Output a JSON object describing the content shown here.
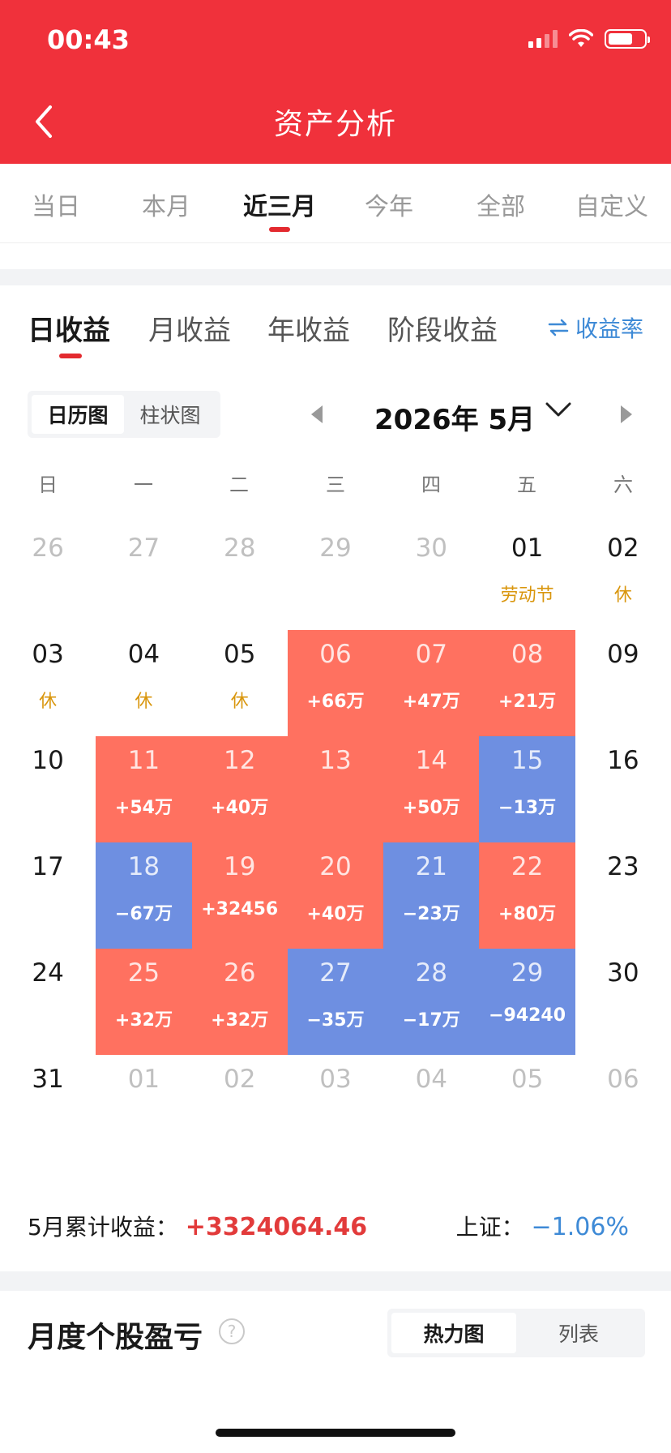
{
  "status": {
    "time": "00:43"
  },
  "header": {
    "title": "资产分析"
  },
  "period_tabs": [
    "当日",
    "本月",
    "近三月",
    "今年",
    "全部",
    "自定义"
  ],
  "period_active": 2,
  "profit_tabs": [
    "日收益",
    "月收益",
    "年收益",
    "阶段收益"
  ],
  "profit_active": 0,
  "rate_label": "收益率",
  "view_toggle": [
    "日历图",
    "柱状图"
  ],
  "month_label": "2026年 5月",
  "weekdays": [
    "日",
    "一",
    "二",
    "三",
    "四",
    "五",
    "六"
  ],
  "calendar": [
    [
      {
        "d": "26",
        "t": "faded"
      },
      {
        "d": "27",
        "t": "faded"
      },
      {
        "d": "28",
        "t": "faded"
      },
      {
        "d": "29",
        "t": "faded"
      },
      {
        "d": "30",
        "t": "faded"
      },
      {
        "d": "01",
        "t": "hol",
        "s": "劳动节"
      },
      {
        "d": "02",
        "t": "hol",
        "s": "休"
      }
    ],
    [
      {
        "d": "03",
        "t": "hol",
        "s": "休"
      },
      {
        "d": "04",
        "t": "hol",
        "s": "休"
      },
      {
        "d": "05",
        "t": "hol",
        "s": "休"
      },
      {
        "d": "06",
        "t": "up",
        "s": "+66万"
      },
      {
        "d": "07",
        "t": "up",
        "s": "+47万"
      },
      {
        "d": "08",
        "t": "up",
        "s": "+21万"
      },
      {
        "d": "09",
        "t": "plain"
      }
    ],
    [
      {
        "d": "10",
        "t": "plain"
      },
      {
        "d": "11",
        "t": "up",
        "s": "+54万"
      },
      {
        "d": "12",
        "t": "up",
        "s": "+40万"
      },
      {
        "d": "13",
        "t": "up",
        "s": ""
      },
      {
        "d": "14",
        "t": "up",
        "s": "+50万"
      },
      {
        "d": "15",
        "t": "down",
        "s": "−13万"
      },
      {
        "d": "16",
        "t": "plain"
      }
    ],
    [
      {
        "d": "17",
        "t": "plain"
      },
      {
        "d": "18",
        "t": "down",
        "s": "−67万"
      },
      {
        "d": "19",
        "t": "up",
        "s": "+32456"
      },
      {
        "d": "20",
        "t": "up",
        "s": "+40万"
      },
      {
        "d": "21",
        "t": "down",
        "s": "−23万"
      },
      {
        "d": "22",
        "t": "up",
        "s": "+80万"
      },
      {
        "d": "23",
        "t": "plain"
      }
    ],
    [
      {
        "d": "24",
        "t": "plain"
      },
      {
        "d": "25",
        "t": "up",
        "s": "+32万"
      },
      {
        "d": "26",
        "t": "up",
        "s": "+32万"
      },
      {
        "d": "27",
        "t": "down",
        "s": "−35万"
      },
      {
        "d": "28",
        "t": "down",
        "s": "−17万"
      },
      {
        "d": "29",
        "t": "down",
        "s": "−94240"
      },
      {
        "d": "30",
        "t": "plain"
      }
    ],
    [
      {
        "d": "31",
        "t": "plain"
      },
      {
        "d": "01",
        "t": "faded"
      },
      {
        "d": "02",
        "t": "faded"
      },
      {
        "d": "03",
        "t": "faded"
      },
      {
        "d": "04",
        "t": "faded"
      },
      {
        "d": "05",
        "t": "faded"
      },
      {
        "d": "06",
        "t": "faded"
      }
    ]
  ],
  "summary": {
    "label": "5月累计收益：",
    "value": "+3324064.46",
    "index_label": "上证：",
    "index_value": "−1.06%"
  },
  "section": {
    "title": "月度个股盈亏",
    "help": "?"
  },
  "section_toggle": [
    "热力图",
    "列表"
  ],
  "colors": {
    "header": "#f0313b",
    "up": "#ff7160",
    "down": "#6e8fe1",
    "holiday": "#d9960d",
    "rate": "#3e8ad6"
  }
}
